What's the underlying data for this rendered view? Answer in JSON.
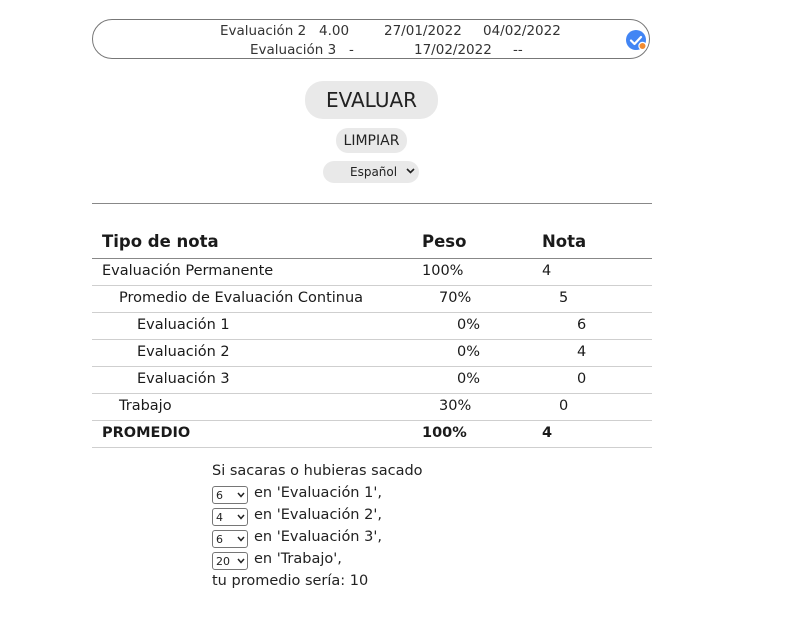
{
  "summary": {
    "rows": [
      {
        "name": "Evaluación 2",
        "grade": "4.00",
        "start": "27/01/2022",
        "end": "04/02/2022"
      },
      {
        "name": "Evaluación 3",
        "grade": "-",
        "start": "17/02/2022",
        "end": "--"
      }
    ]
  },
  "buttons": {
    "evaluar": "EVALUAR",
    "limpiar": "LIMPIAR"
  },
  "language": {
    "selected": "Español"
  },
  "table": {
    "headers": {
      "type": "Tipo de nota",
      "weight": "Peso",
      "grade": "Nota"
    },
    "rows": [
      {
        "label": "Evaluación Permanente",
        "weight": "100%",
        "grade": "4"
      },
      {
        "label": "Promedio de Evaluación Continua",
        "weight": "70%",
        "grade": "5"
      },
      {
        "label": "Evaluación 1",
        "weight": "0%",
        "grade": "6"
      },
      {
        "label": "Evaluación 2",
        "weight": "0%",
        "grade": "4"
      },
      {
        "label": "Evaluación 3",
        "weight": "0%",
        "grade": "0"
      },
      {
        "label": "Trabajo",
        "weight": "30%",
        "grade": "0"
      },
      {
        "label": "PROMEDIO",
        "weight": "100%",
        "grade": "4"
      }
    ]
  },
  "simulation": {
    "intro": "Si sacaras o hubieras sacado",
    "items": [
      {
        "value": "6",
        "text": "en 'Evaluación 1',"
      },
      {
        "value": "4",
        "text": "en 'Evaluación 2',"
      },
      {
        "value": "6",
        "text": "en 'Evaluación 3',"
      },
      {
        "value": "20",
        "text": "en 'Trabajo',"
      }
    ],
    "result": "tu promedio sería: 10"
  },
  "colors": {
    "check_badge": "#4285f4",
    "check_dot": "#f28b30"
  },
  "icons": {
    "status": "check-circle-icon",
    "dropdown": "chevron-down-icon"
  }
}
